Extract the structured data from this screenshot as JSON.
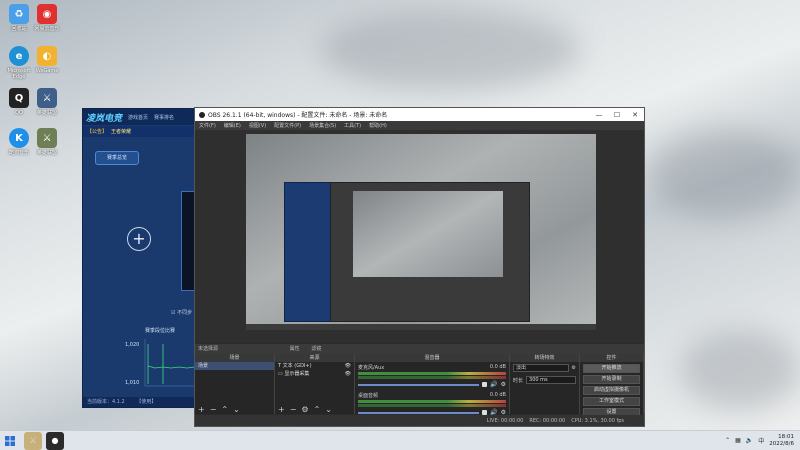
{
  "desktop": {
    "icons": [
      {
        "label": "回收站",
        "icon": "recycle-bin-icon",
        "color": "#4aa0e8"
      },
      {
        "label": "网易云音乐",
        "icon": "netease-music-icon",
        "color": "#e03030"
      },
      {
        "label": "Microsoft Edge",
        "icon": "edge-icon",
        "color": "#1f8fd6"
      },
      {
        "label": "WeGame",
        "icon": "wegame-icon",
        "color": "#f2b230"
      },
      {
        "label": "QQ",
        "icon": "qq-icon",
        "color": "#222222"
      },
      {
        "label": "英雄联盟",
        "icon": "lol-icon",
        "color": "#3e5f8a"
      },
      {
        "label": "酷狗音乐",
        "icon": "kugou-icon",
        "color": "#1f8fe8"
      },
      {
        "label": "英雄联盟",
        "icon": "lol-icon",
        "color": "#6f7f55"
      }
    ]
  },
  "game_window": {
    "logo": "凌岚电竞",
    "nav": [
      "游戏首页",
      "赛事排名"
    ],
    "notice_tag": "【公告】",
    "notice_text": "王者荣耀",
    "badge": "赛季总览",
    "plus": "+",
    "checkbox_label": "不同步",
    "stat_title": "赛季段位比赛",
    "axis_ticks": [
      "1,020",
      "1,010"
    ],
    "footer": "当前版本：4.1.2",
    "footer_right": "【使用】"
  },
  "obs": {
    "title": "OBS 26.1.1 (64-bit, windows) - 配置文件: 未命名 - 场景: 未命名",
    "menu": [
      "文件(F)",
      "编辑(E)",
      "视图(V)",
      "配置文件(P)",
      "场景集合(S)",
      "工具(T)",
      "帮助(H)"
    ],
    "dock_header_sources": "未选择源",
    "dock_header_props": "属性",
    "dock_header_filters": "滤镜",
    "docks": {
      "scenes": {
        "title": "场景",
        "items": [
          "场景"
        ]
      },
      "sources": {
        "title": "来源",
        "items": [
          "文本 (GDI+)",
          "显示器采集"
        ]
      },
      "mixer": {
        "title": "混音器",
        "channels": [
          {
            "name": "麦克风/Aux",
            "db": "0.0 dB"
          },
          {
            "name": "桌面音频",
            "db": "0.0 dB"
          }
        ]
      },
      "transitions": {
        "title": "转场特效",
        "type": "淡出",
        "duration_label": "时长",
        "duration": "300 ms"
      },
      "controls": {
        "title": "控件",
        "buttons": [
          "开始推流",
          "开始录制",
          "启动虚拟摄像机",
          "工作室模式",
          "设置",
          "退出"
        ]
      }
    },
    "status": {
      "live": "LIVE: 00:00:00",
      "rec": "REC: 00:00:00",
      "cpu": "CPU: 3.1%, 30.00 fps"
    }
  },
  "taskbar": {
    "time": "18:01",
    "date": "2022/8/6"
  }
}
